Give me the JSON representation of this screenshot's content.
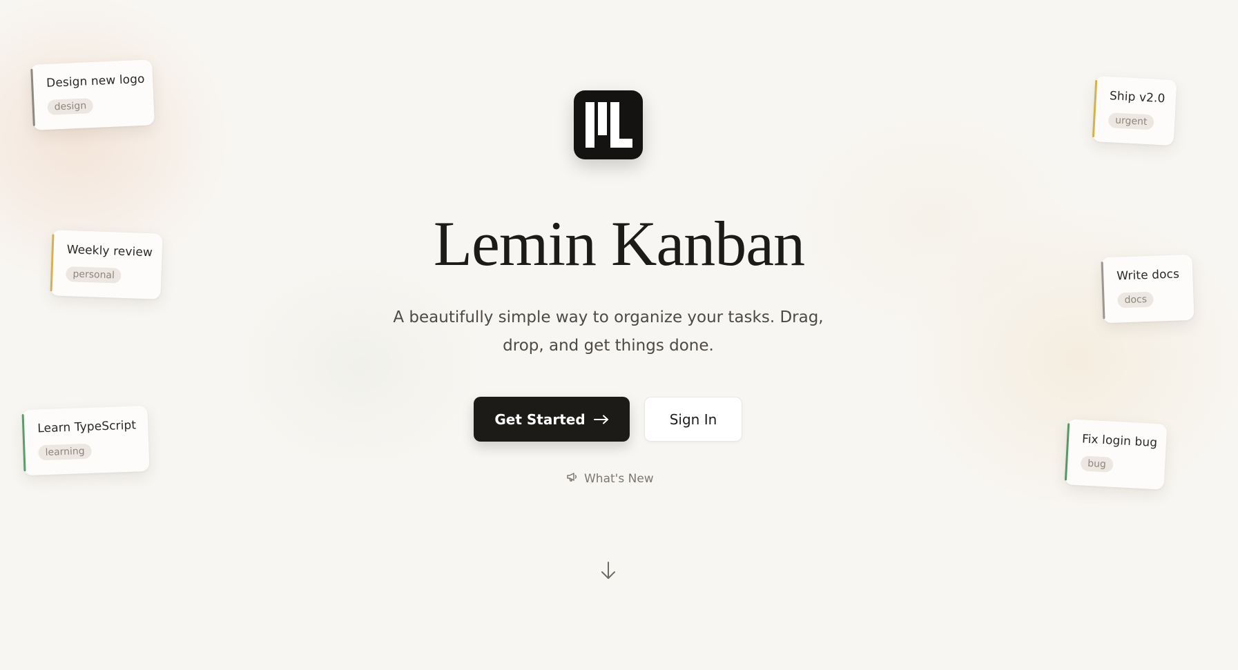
{
  "app": {
    "title": "Lemin Kanban",
    "subtitle": "A beautifully simple way to organize your tasks. Drag, drop, and get things done.",
    "logo_icon": "lemin-logo-icon"
  },
  "actions": {
    "get_started_label": "Get Started",
    "get_started_icon": "arrow-right-icon",
    "sign_in_label": "Sign In",
    "whats_new_label": "What's New",
    "whats_new_icon": "megaphone-icon",
    "scroll_icon": "arrow-down-icon"
  },
  "floating_cards": [
    {
      "title": "Design new logo",
      "tag": "design",
      "accent": "#8c8882"
    },
    {
      "title": "Weekly review",
      "tag": "personal",
      "accent": "#d6b14c"
    },
    {
      "title": "Learn TypeScript",
      "tag": "learning",
      "accent": "#5e9a6a"
    },
    {
      "title": "Ship v2.0",
      "tag": "urgent",
      "accent": "#d4b24a"
    },
    {
      "title": "Write docs",
      "tag": "docs",
      "accent": "#9a9690"
    },
    {
      "title": "Fix login bug",
      "tag": "bug",
      "accent": "#5a9566"
    }
  ],
  "colors": {
    "background": "#f8f6f2",
    "primary_button": "#1d1b18",
    "text": "#1c1b18"
  }
}
